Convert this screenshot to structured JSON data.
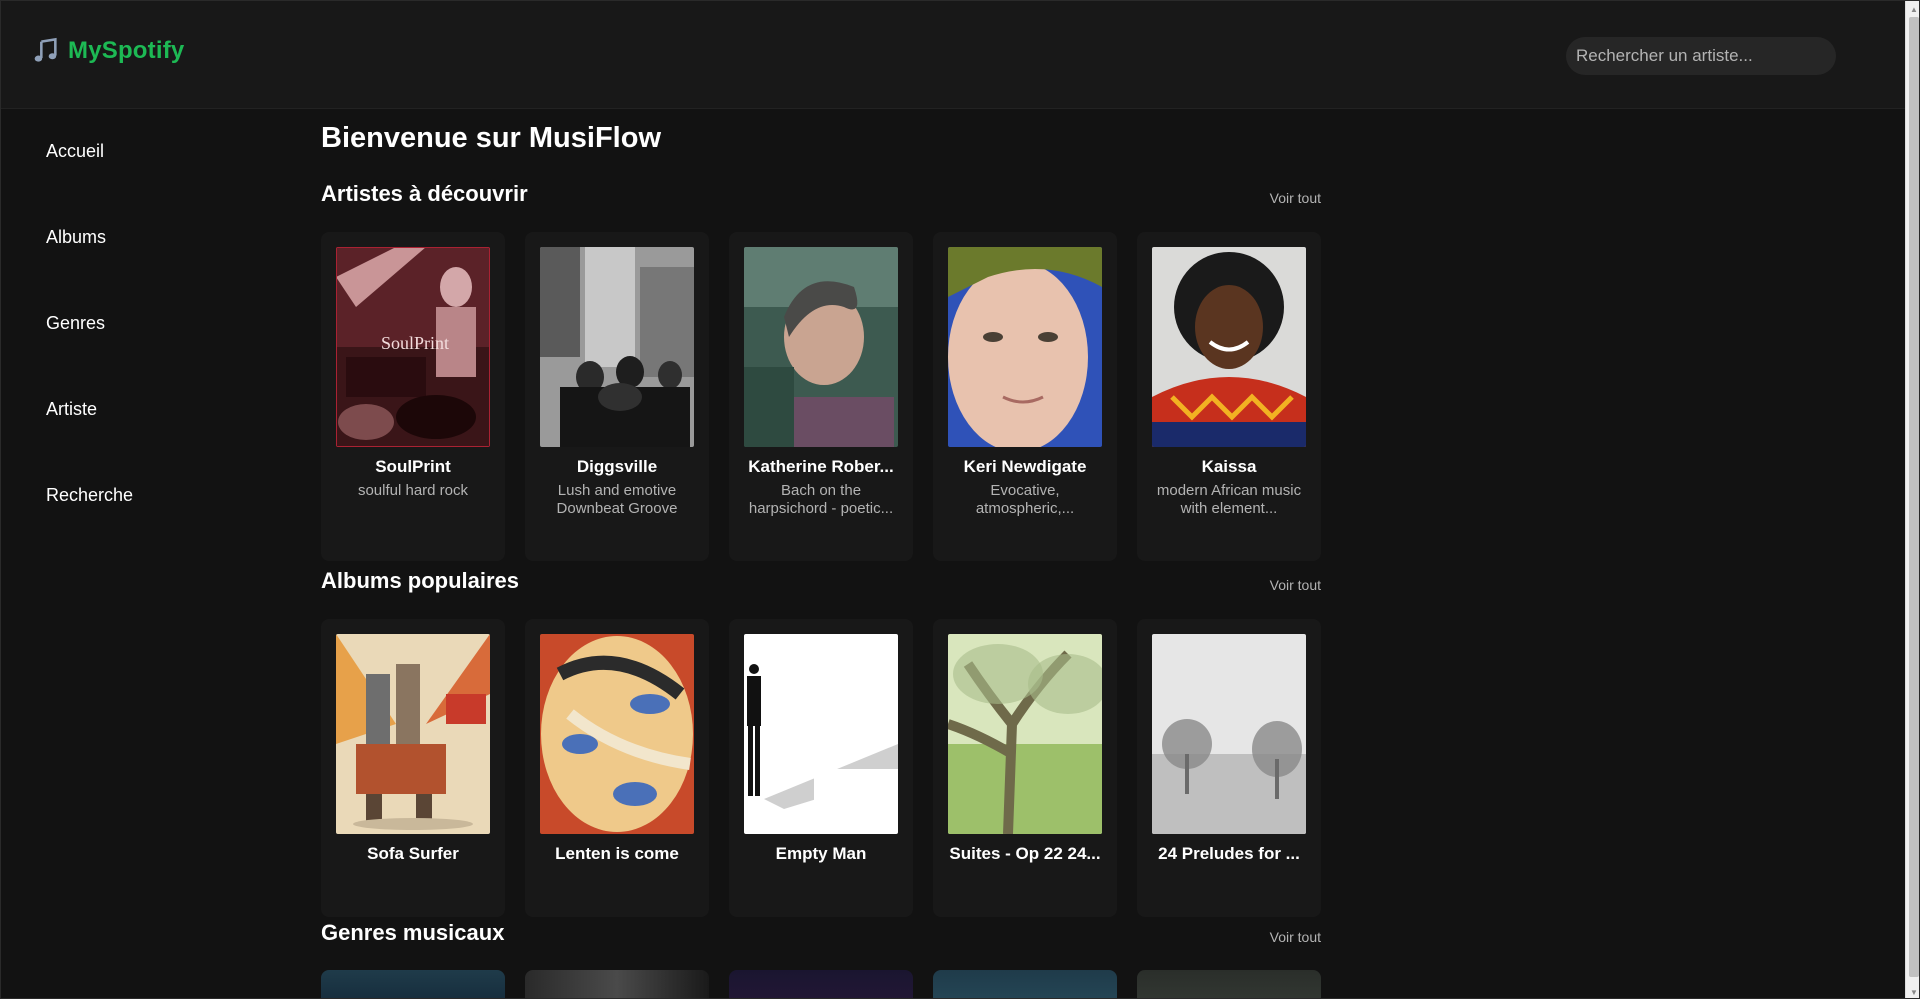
{
  "app": {
    "title": "MySpotify",
    "brand_color": "#1db954"
  },
  "header": {
    "search_placeholder": "Rechercher un artiste..."
  },
  "sidebar": {
    "items": [
      {
        "label": "Accueil"
      },
      {
        "label": "Albums"
      },
      {
        "label": "Genres"
      },
      {
        "label": "Artiste"
      },
      {
        "label": "Recherche"
      }
    ]
  },
  "main": {
    "title": "Bienvenue sur MusiFlow",
    "artists": {
      "title": "Artistes à découvrir",
      "see_all": "Voir tout",
      "items": [
        {
          "name": "SoulPrint",
          "description": "soulful hard rock"
        },
        {
          "name": "Diggsville",
          "description": "Lush and emotive Downbeat Groove"
        },
        {
          "name": "Katherine Rober...",
          "description": "Bach on the harpsichord - poetic..."
        },
        {
          "name": "Keri Newdigate",
          "description": "Evocative, atmospheric,..."
        },
        {
          "name": "Kaissa",
          "description": "modern African music with element..."
        }
      ]
    },
    "albums": {
      "title": "Albums populaires",
      "see_all": "Voir tout",
      "items": [
        {
          "name": "Sofa Surfer"
        },
        {
          "name": "Lenten is come"
        },
        {
          "name": "Empty Man"
        },
        {
          "name": "Suites - Op 22 24..."
        },
        {
          "name": "24 Preludes for ..."
        }
      ]
    },
    "genres": {
      "title": "Genres musicaux",
      "see_all": "Voir tout"
    }
  }
}
